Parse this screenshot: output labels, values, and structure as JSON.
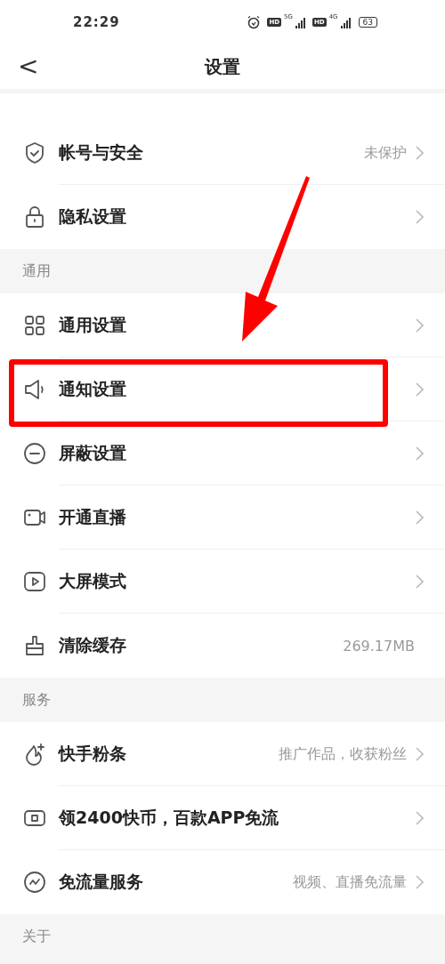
{
  "status_bar": {
    "time": "22:29",
    "sim1": {
      "hd": "HD",
      "network": "5G"
    },
    "sim2": {
      "hd": "HD",
      "network": "4G"
    },
    "battery": "63"
  },
  "header": {
    "back": "<",
    "title": "设置"
  },
  "sections": [
    {
      "items": [
        {
          "label": "帐号与安全",
          "value": "未保护",
          "highlighted": false
        },
        {
          "label": "隐私设置",
          "highlighted": false
        }
      ]
    },
    {
      "title": "通用",
      "items": [
        {
          "label": "通用设置",
          "highlighted": false
        },
        {
          "label": "通知设置",
          "highlighted": true
        },
        {
          "label": "屏蔽设置",
          "highlighted": false
        },
        {
          "label": "开通直播",
          "highlighted": false
        },
        {
          "label": "大屏模式",
          "highlighted": false
        },
        {
          "label": "清除缓存",
          "value": "269.17MB",
          "chevron": false,
          "highlighted": false
        }
      ]
    },
    {
      "title": "服务",
      "items": [
        {
          "label": "快手粉条",
          "value": "推广作品，收获粉丝",
          "highlighted": false
        },
        {
          "label": "领2400快币，百款APP免流",
          "highlighted": false
        },
        {
          "label": "免流量服务",
          "value": "视频、直播免流量",
          "highlighted": false
        }
      ]
    },
    {
      "title": "关于"
    }
  ]
}
